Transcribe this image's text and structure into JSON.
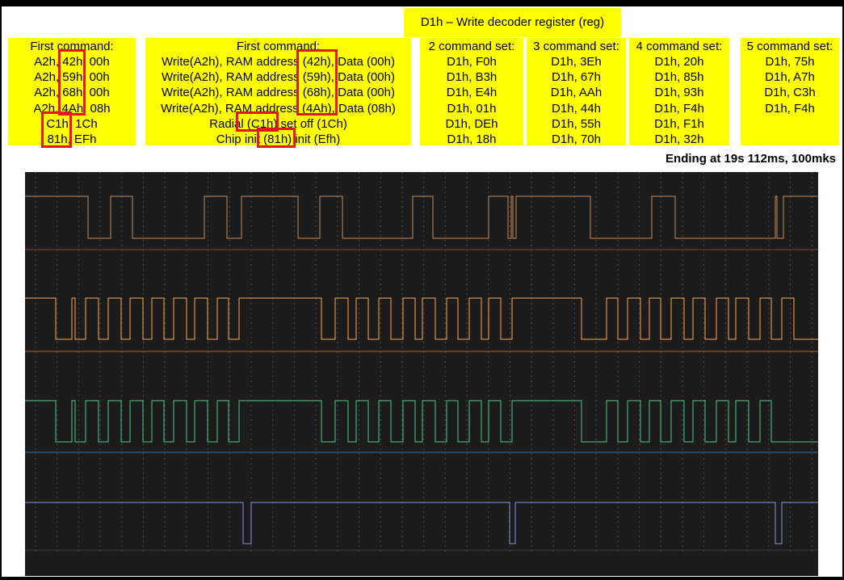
{
  "title": "D1h – Write decoder register (reg)",
  "ending_text": "Ending at 19s 112ms, 100mks",
  "first_cmd": {
    "header": "First command:",
    "lines": [
      "A2h, 42h, 00h",
      "A2h, 59h, 00h",
      "A2h, 68h, 00h",
      "A2h, 4Ah, 08h",
      "C1h, 1Ch",
      "81h, EFh"
    ]
  },
  "first_cmd_desc": {
    "header": "First command:",
    "lines": [
      "Write(A2h), RAM address (42h), Data (00h)",
      "Write(A2h), RAM address (59h), Data (00h)",
      "Write(A2h), RAM address (68h), Data (00h)",
      "Write(A2h), RAM address (4Ah), Data (08h)",
      "Radial (C1h) set off (1Ch)",
      "Chip init (81h) init (Efh)"
    ]
  },
  "set2": {
    "header": "2 command set:",
    "lines": [
      "D1h, F0h",
      "D1h, B3h",
      "D1h, E4h",
      "D1h, 01h",
      "D1h, DEh",
      "D1h, 18h"
    ]
  },
  "set3": {
    "header": "3 command set:",
    "lines": [
      "D1h, 3Eh",
      "D1h, 67h",
      "D1h, AAh",
      "D1h, 44h",
      "D1h, 55h",
      "D1h, 70h"
    ]
  },
  "set4": {
    "header": "4 command set:",
    "lines": [
      "D1h, 20h",
      "D1h, 85h",
      "D1h, 93h",
      "D1h, F4h",
      "D1h, F1h",
      "D1h, 32h"
    ]
  },
  "set5": {
    "header": "5 command set:",
    "lines": [
      "D1h, 75h",
      "D1h, A7h",
      "D1h, C3h",
      "D1h, F4h"
    ]
  },
  "colors": {
    "highlight_bg": "#ffff00",
    "highlight_border": "#e8141e",
    "scope_bg": "#1c1c1c",
    "ch1": "#c48a5c",
    "ch2": "#ffa64d",
    "ch3": "#4fc987",
    "ch4": "#8a8fe0"
  }
}
